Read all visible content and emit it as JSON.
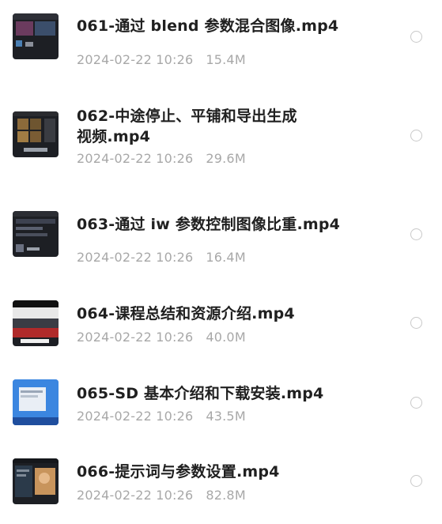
{
  "files": [
    {
      "title_line1": "061-通过 blend 参数混合图像.mp4",
      "title_line2": "",
      "date": "2024-02-22 10:26",
      "size": "15.4M",
      "thumb_icon": "video-thumbnail-icon",
      "selected": false
    },
    {
      "title_line1": "062-中途停止、平铺和导出生成",
      "title_line2": "视频.mp4",
      "date": "2024-02-22 10:26",
      "size": "29.6M",
      "thumb_icon": "video-thumbnail-icon",
      "selected": false
    },
    {
      "title_line1": "063-通过 iw 参数控制图像比重.mp4",
      "title_line2": "",
      "date": "2024-02-22 10:26",
      "size": "16.4M",
      "thumb_icon": "video-thumbnail-icon",
      "selected": false
    },
    {
      "title_line1": "064-课程总结和资源介绍.mp4",
      "title_line2": "",
      "date": "2024-02-22 10:26",
      "size": "40.0M",
      "thumb_icon": "video-thumbnail-icon",
      "selected": false
    },
    {
      "title_line1": "065-SD 基本介绍和下载安装.mp4",
      "title_line2": "",
      "date": "2024-02-22 10:26",
      "size": "43.5M",
      "thumb_icon": "video-thumbnail-icon",
      "selected": false
    },
    {
      "title_line1": "066-提示词与参数设置.mp4",
      "title_line2": "",
      "date": "2024-02-22 10:26",
      "size": "82.8M",
      "thumb_icon": "video-thumbnail-icon",
      "selected": false
    }
  ],
  "colors": {
    "title": "#202020",
    "meta": "#a8a8a8",
    "radio_border": "#c9c9c9",
    "background": "#ffffff"
  }
}
